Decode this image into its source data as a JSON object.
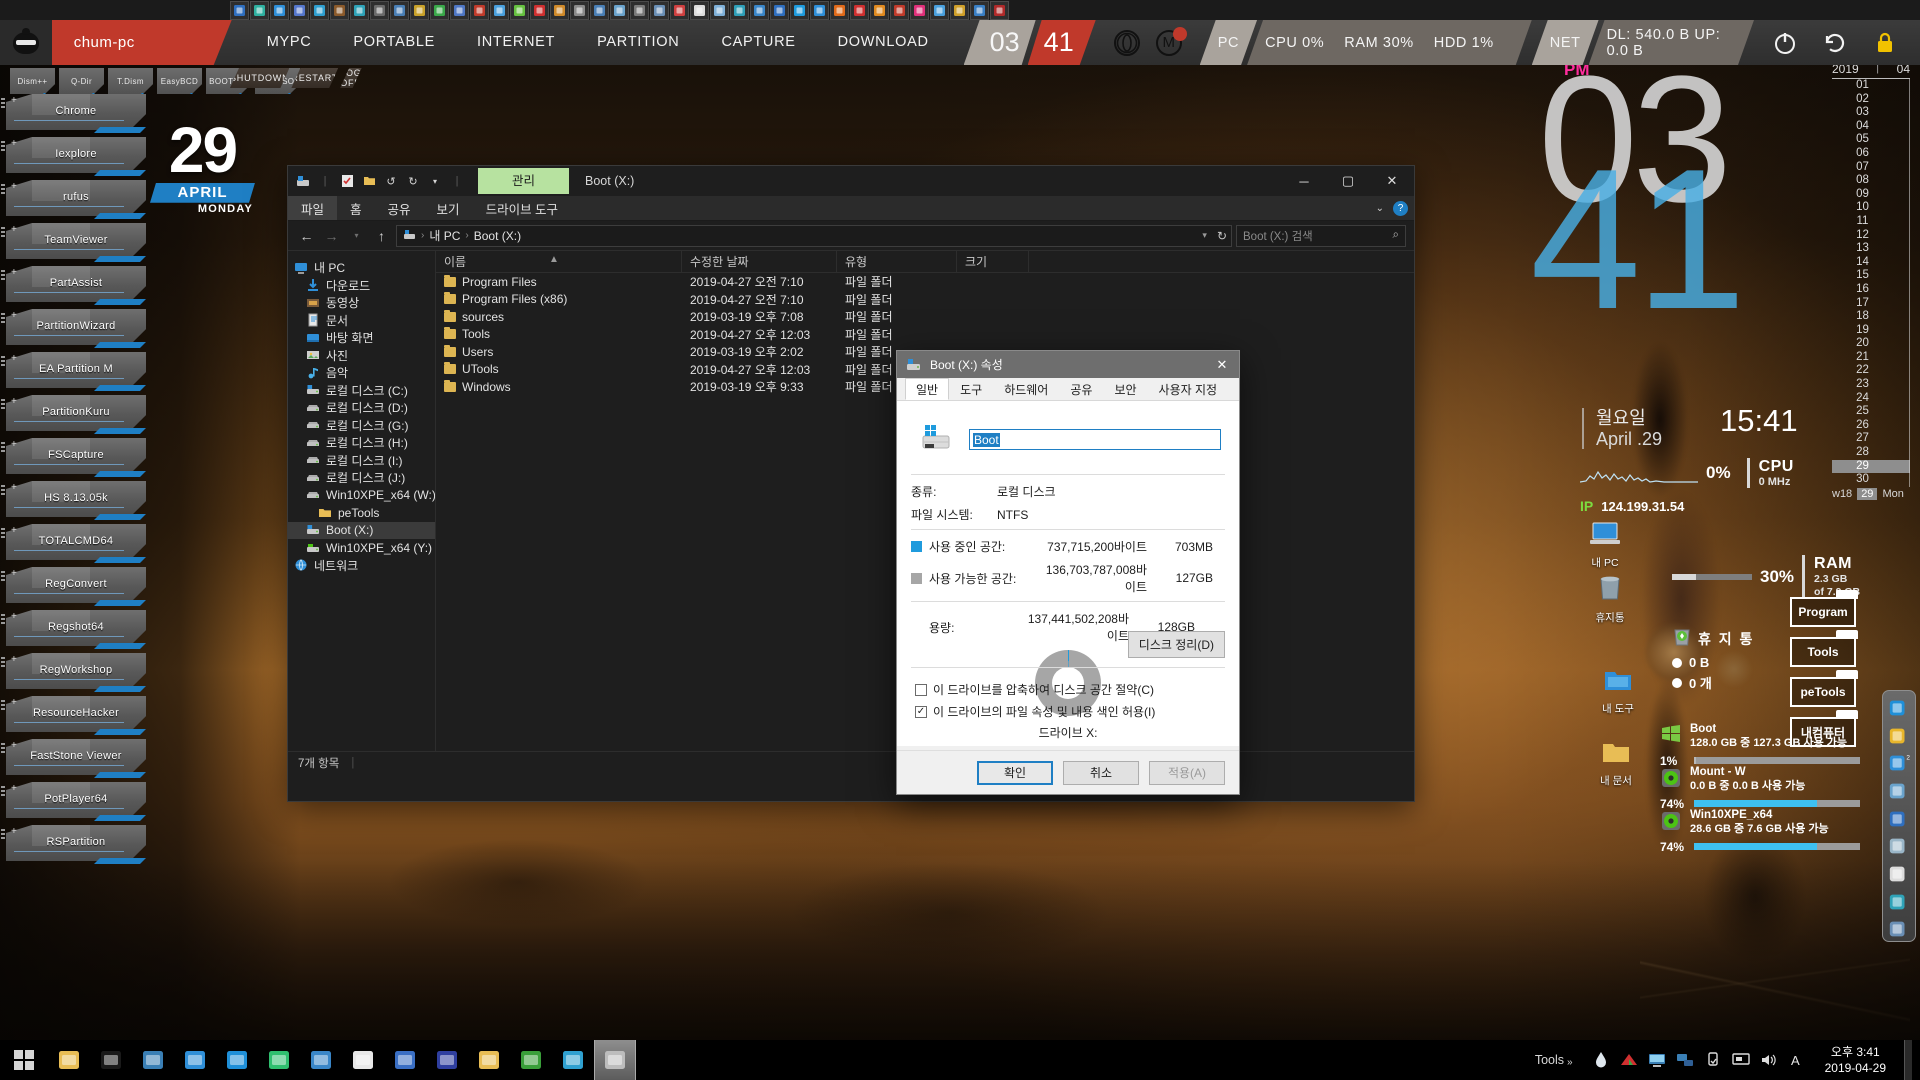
{
  "topstrip": {
    "icons": [
      "windows-logo-icon",
      "delta-triangle-icon",
      "grid-blue-icon",
      "letter-a-icon",
      "paint-bucket-icon",
      "bridge-br-icon",
      "teal-disc-icon",
      "monitor-icon",
      "clock-gauge-icon",
      "wrench-yellow-icon",
      "green-g-icon",
      "pen-blue-icon",
      "globe-red-icon",
      "speaker-blue-icon",
      "green-usb-icon",
      "red-flag-icon",
      "orange-drum-icon",
      "pencil-icon",
      "blue-monitor-icon",
      "network-tool-icon",
      "scanner-icon",
      "mouse-tool-icon",
      "floppy-save-icon",
      "diamond-white-icon",
      "megaphone-icon",
      "book-teal-icon",
      "gear-blue-icon",
      "globe-browser-icon",
      "blue-swirl-icon",
      "internet-explorer-icon",
      "firefox-icon",
      "red-frame-icon",
      "orange-disc-icon",
      "resource-hacker-icon",
      "pink-monitor-icon",
      "water-drop-icon",
      "yellow-r-icon",
      "blue-key-icon",
      "rs-logo-icon"
    ]
  },
  "topbar": {
    "hostname": "chum-pc",
    "menu": [
      "MYPC",
      "PORTABLE",
      "INTERNET",
      "PARTITION",
      "CAPTURE",
      "DOWNLOAD"
    ],
    "clock_hour": "03",
    "clock_minute": "41",
    "logos": [
      "opera-circle-icon",
      "m-circle-icon"
    ],
    "pc_label": "PC",
    "stats": [
      "CPU 0%",
      "RAM 30%",
      "HDD 1%"
    ],
    "net_label": "NET",
    "net_stats": "DL: 540.0 B  UP: 0.0 B",
    "power_icons": [
      "power-icon",
      "restart-icon",
      "lock-icon"
    ]
  },
  "launcher": {
    "top_tabs": [
      "Dism++",
      "Q-Dir",
      "T.Dism",
      "EasyBCD",
      "BOOTICE",
      "UltraISO"
    ],
    "power_tabs": [
      "SHUTDOWN",
      "RESTART",
      "LOG OFF"
    ],
    "buttons": [
      "Chrome",
      "Iexplore",
      "rufus",
      "TeamViewer",
      "PartAssist",
      "PartitionWizard",
      "EA Partition M",
      "PartitionKuru",
      "FSCapture",
      "HS 8.13.05k",
      "TOTALCMD64",
      "RegConvert",
      "Regshot64",
      "RegWorkshop",
      "ResourceHacker",
      "FastStone Viewer",
      "PotPlayer64",
      "RSPartition"
    ]
  },
  "calendar_widget": {
    "day": "29",
    "month": "APRIL",
    "weekday": "MONDAY"
  },
  "explorer": {
    "quick_access_icons": [
      "drive-properties-icon",
      "checklist-icon",
      "folder-yellow-icon",
      "undo-icon",
      "redo-icon",
      "customize-dropdown-icon"
    ],
    "context_tab": "관리",
    "window_title": "Boot (X:)",
    "window_buttons": [
      "minimize-icon",
      "maximize-icon",
      "close-icon"
    ],
    "ribbon_tabs": [
      "파일",
      "홈",
      "공유",
      "보기",
      "드라이브 도구"
    ],
    "ribbon_active_tab": "파일",
    "ribbon_right": [
      "chevron-down-icon",
      "help-icon"
    ],
    "help_glyph": "?",
    "nav_buttons": [
      "back-icon",
      "forward-icon",
      "recent-dropdown-icon",
      "up-icon"
    ],
    "breadcrumbs": [
      "내 PC",
      "Boot (X:)"
    ],
    "address_refresh_icon": "refresh-icon",
    "search_placeholder": "Boot (X:) 검색",
    "search_value": "",
    "tree": [
      {
        "label": "내 PC",
        "icon": "monitor-icon",
        "depth": 1,
        "selected": false
      },
      {
        "label": "다운로드",
        "icon": "download-arrow-icon",
        "depth": 2,
        "selected": false
      },
      {
        "label": "동영상",
        "icon": "video-icon",
        "depth": 2,
        "selected": false
      },
      {
        "label": "문서",
        "icon": "document-icon",
        "depth": 2,
        "selected": false
      },
      {
        "label": "바탕 화면",
        "icon": "desktop-icon",
        "depth": 2,
        "selected": false
      },
      {
        "label": "사진",
        "icon": "picture-icon",
        "depth": 2,
        "selected": false
      },
      {
        "label": "음악",
        "icon": "music-note-icon",
        "depth": 2,
        "selected": false
      },
      {
        "label": "로컬 디스크 (C:)",
        "icon": "system-drive-icon",
        "depth": 2,
        "selected": false
      },
      {
        "label": "로컬 디스크 (D:)",
        "icon": "drive-icon",
        "depth": 2,
        "selected": false
      },
      {
        "label": "로컬 디스크 (G:)",
        "icon": "drive-icon",
        "depth": 2,
        "selected": false
      },
      {
        "label": "로컬 디스크 (H:)",
        "icon": "drive-icon",
        "depth": 2,
        "selected": false
      },
      {
        "label": "로컬 디스크 (I:)",
        "icon": "drive-icon",
        "depth": 2,
        "selected": false
      },
      {
        "label": "로컬 디스크 (J:)",
        "icon": "drive-icon",
        "depth": 2,
        "selected": false
      },
      {
        "label": "Win10XPE_x64 (W:)",
        "icon": "drive-icon",
        "depth": 2,
        "selected": false
      },
      {
        "label": "peTools",
        "icon": "folder-yellow-icon",
        "depth": 3,
        "selected": false
      },
      {
        "label": "Boot (X:)",
        "icon": "system-drive-icon",
        "depth": 2,
        "selected": true
      },
      {
        "label": "Win10XPE_x64 (Y:)",
        "icon": "network-drive-icon",
        "depth": 2,
        "selected": false
      },
      {
        "label": "네트워크",
        "icon": "network-icon",
        "depth": 1,
        "selected": false
      }
    ],
    "columns": [
      "이름",
      "수정한 날짜",
      "유형",
      "크기"
    ],
    "sort_indicator": "▲",
    "files": [
      {
        "name": "Program Files",
        "modified": "2019-04-27 오전 7:10",
        "type": "파일 폴더",
        "size": ""
      },
      {
        "name": "Program Files (x86)",
        "modified": "2019-04-27 오전 7:10",
        "type": "파일 폴더",
        "size": ""
      },
      {
        "name": "sources",
        "modified": "2019-03-19 오후 7:08",
        "type": "파일 폴더",
        "size": ""
      },
      {
        "name": "Tools",
        "modified": "2019-04-27 오후 12:03",
        "type": "파일 폴더",
        "size": ""
      },
      {
        "name": "Users",
        "modified": "2019-03-19 오후 2:02",
        "type": "파일 폴더",
        "size": ""
      },
      {
        "name": "UTools",
        "modified": "2019-04-27 오후 12:03",
        "type": "파일 폴더",
        "size": ""
      },
      {
        "name": "Windows",
        "modified": "2019-03-19 오후 9:33",
        "type": "파일 폴더",
        "size": ""
      }
    ],
    "status_count": "7개 항목"
  },
  "properties_dialog": {
    "title": "Boot (X:) 속성",
    "title_icon": "drive-icon",
    "close_glyph": "✕",
    "tabs": [
      "일반",
      "도구",
      "하드웨어",
      "공유",
      "보안",
      "사용자 지정"
    ],
    "active_tab": "일반",
    "volume_icon": "windows-drive-icon",
    "volume_name": "Boot",
    "type_label": "종류:",
    "type_value": "로컬 디스크",
    "fs_label": "파일 시스템:",
    "fs_value": "NTFS",
    "used_label": "사용 중인 공간:",
    "used_bytes": "737,715,200바이트",
    "used_gb": "703MB",
    "free_label": "사용 가능한 공간:",
    "free_bytes": "136,703,787,008바이트",
    "free_gb": "127GB",
    "capacity_label": "용량:",
    "capacity_bytes": "137,441,502,208바이트",
    "capacity_gb": "128GB",
    "drive_label": "드라이브 X:",
    "cleanup_button": "디스크 정리(D)",
    "checkbox_compress": "이 드라이브를 압축하여 디스크 공간 절약(C)",
    "checkbox_compress_checked": false,
    "checkbox_index": "이 드라이브의 파일 속성 및 내용 색인 허용(I)",
    "checkbox_index_checked": true,
    "check_glyph": "✓",
    "buttons": {
      "ok": "확인",
      "cancel": "취소",
      "apply": "적용(A)"
    },
    "used_percent": 0.54,
    "colors": {
      "used": "#1f9bdd",
      "free": "#a6a6a6",
      "accent": "#1f7fc4"
    }
  },
  "clock_widget": {
    "meridiem": "PM",
    "hour": "03",
    "minute": "41",
    "weekday": "월요일",
    "date": "April .29",
    "time24": "15:41",
    "cpu_percent": "0%",
    "cpu_label": "CPU",
    "cpu_freq": "0 MHz",
    "ip_label": "IP",
    "ip_value": "124.199.31.54",
    "ram_percent": "30%",
    "ram_label": "RAM",
    "ram_used": "2.3 GB",
    "ram_total": "of 7.9 GB"
  },
  "month_column": {
    "year": "2019",
    "month": "04",
    "days": [
      "01",
      "02",
      "03",
      "04",
      "05",
      "06",
      "07",
      "08",
      "09",
      "10",
      "11",
      "12",
      "13",
      "14",
      "15",
      "16",
      "17",
      "18",
      "19",
      "20",
      "21",
      "22",
      "23",
      "24",
      "25",
      "26",
      "27",
      "28",
      "29",
      "30"
    ],
    "today": "29",
    "week_label": "w18",
    "today_label": "29",
    "weekday_short": "Mon"
  },
  "recycle_bin": {
    "label": "휴 지 통",
    "size": "0 B",
    "count": "0 개",
    "icon": "recycle-bin-icon"
  },
  "desktop_shortcuts": [
    {
      "label": "Program",
      "name": "shortcut-program"
    },
    {
      "label": "Tools",
      "name": "shortcut-tools"
    },
    {
      "label": "peTools",
      "name": "shortcut-petools"
    },
    {
      "label": "내컴퓨터",
      "name": "shortcut-mycomputer"
    }
  ],
  "desktop_icons": [
    {
      "label": "내 PC",
      "icon": "computer-icon"
    },
    {
      "label": "휴지통",
      "icon": "recycle-bin-icon"
    },
    {
      "label": "내 도구",
      "icon": "tools-folder-icon"
    },
    {
      "label": "내 문서",
      "icon": "documents-folder-icon"
    }
  ],
  "disk_widgets": [
    {
      "name": "Boot",
      "detail": "128.0 GB 중 127.3 GB 사용 가능",
      "percent": "1%",
      "fill": 1,
      "icon": "windows-flag-icon"
    },
    {
      "name": "Mount - W",
      "detail": "0.0 B 중    0.0 B 사용 가능",
      "percent": "74%",
      "fill": 74,
      "icon": "green-disc-icon"
    },
    {
      "name": "Win10XPE_x64",
      "detail": "28.6 GB 중  7.6 GB 사용 가능",
      "percent": "74%",
      "fill": 74,
      "icon": "green-disc-icon"
    }
  ],
  "right_dock": {
    "icons": [
      "internet-explorer-icon",
      "chrome-icon",
      "blue-triangle-icon",
      "window-snip-icon",
      "blue-screen-icon",
      "laptop-icon",
      "diamond-icon",
      "book-teal-icon",
      "network-tool-icon"
    ],
    "badge": "2"
  },
  "taskbar": {
    "start_icon": "start-grid-icon",
    "items": [
      "file-explorer-icon",
      "command-prompt-icon",
      "blue-folder-icon",
      "chart-monitor-icon",
      "internet-explorer-icon",
      "colorbars-icon",
      "display-settings-icon",
      "paper-white-icon",
      "blue-grid-icon",
      "floppy-save-icon",
      "folder-upload-icon",
      "install-green-icon",
      "recycle-refresh-icon",
      "drive-properties-icon"
    ],
    "active_index": 13,
    "tray_label": "Tools",
    "tray_chevron": "»",
    "tray_icons": [
      "water-drop-icon",
      "red-triangle-icon",
      "monitor-icon",
      "network-icon",
      "usb-eject-icon",
      "display-icon",
      "volume-icon",
      "ime-a-icon"
    ],
    "clock_time": "오후 3:41",
    "clock_date": "2019-04-29"
  }
}
